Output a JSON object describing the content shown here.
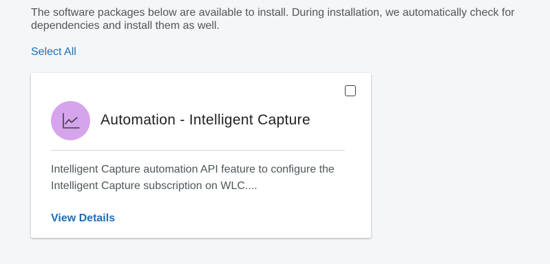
{
  "intro": {
    "text": "The software packages below are available to install. During installation, we automatically check for dependencies and install them as well."
  },
  "select_all_label": "Select All",
  "package_card": {
    "icon": "line-chart-icon",
    "icon_bg_color": "#d6a4ec",
    "title": "Automation - Intelligent Capture",
    "description": "Intelligent Capture automation API feature to configure the Intelligent Capture subscription on WLC....",
    "view_details_label": "View Details",
    "checked": false
  },
  "colors": {
    "link": "#1f6eb3",
    "text": "#4e5559",
    "title": "#1d1f21"
  }
}
